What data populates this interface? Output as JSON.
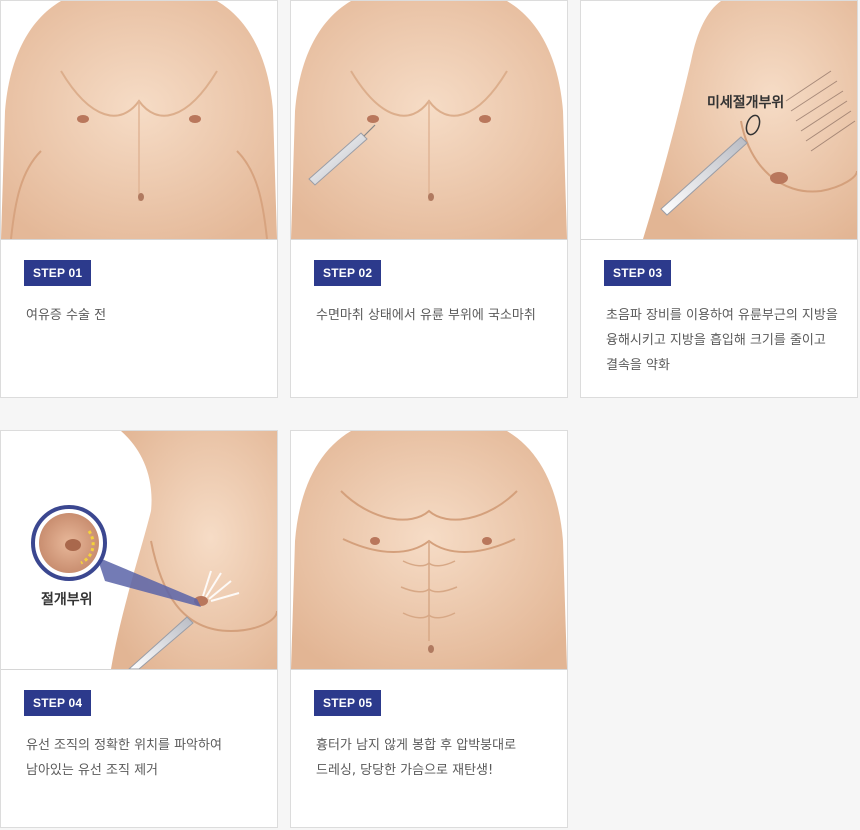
{
  "steps": [
    {
      "badge": "STEP 01",
      "description": "여유증 수술 전",
      "illustration": "chest-before-surgery"
    },
    {
      "badge": "STEP 02",
      "description": "수면마취 상태에서 유륜 부위에 국소마취",
      "illustration": "local-anesthesia-needle"
    },
    {
      "badge": "STEP 03",
      "description": "초음파 장비를 이용하여 유륜부근의 지방을\n융해시키고 지방을 흡입해 크기를 줄이고\n결속을 약화",
      "illustration": "ultrasound-liposuction",
      "overlay_label": "미세절개부위"
    },
    {
      "badge": "STEP 04",
      "description": "유선 조직의 정확한 위치를 파악하여\n남아있는 유선 조직 제거",
      "illustration": "gland-tissue-removal",
      "overlay_label": "절개부위"
    },
    {
      "badge": "STEP 05",
      "description": "흉터가 남지 않게 봉합 후 압박붕대로\n드레싱, 당당한 가슴으로 재탄생!",
      "illustration": "chest-after-surgery"
    }
  ],
  "colors": {
    "badge_background": "#2c3a8c",
    "skin": "#f0cfb3",
    "page_background": "#f6f6f6"
  }
}
